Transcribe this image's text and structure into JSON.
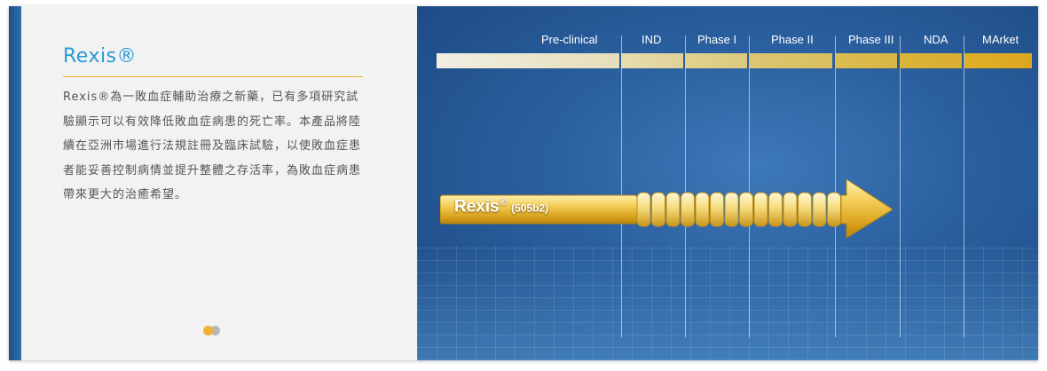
{
  "product": {
    "name": "Rexis",
    "mark": "®",
    "description": "Rexis®為一敗血症輔助治療之新藥，已有多項研究試驗顯示可以有效降低敗血症病患的死亡率。本產品將陸續在亞洲市場進行法規註冊及臨床試驗，以使敗血症患者能妥善控制病情並提升整體之存活率，為敗血症病患帶來更大的治癒希望。"
  },
  "pager": {
    "slides": 2,
    "active": 1
  },
  "pipeline": {
    "phases": [
      "Pre-clinical",
      "IND",
      "Phase I",
      "Phase II",
      "Phase III",
      "NDA",
      "MArket"
    ],
    "drug": {
      "name": "Rexis",
      "mark": "®",
      "code": "(505b2)"
    }
  },
  "colors": {
    "accent": "#2a9bd3",
    "gold": "#f0b030",
    "pipeline_background": "#2a5f9f"
  }
}
